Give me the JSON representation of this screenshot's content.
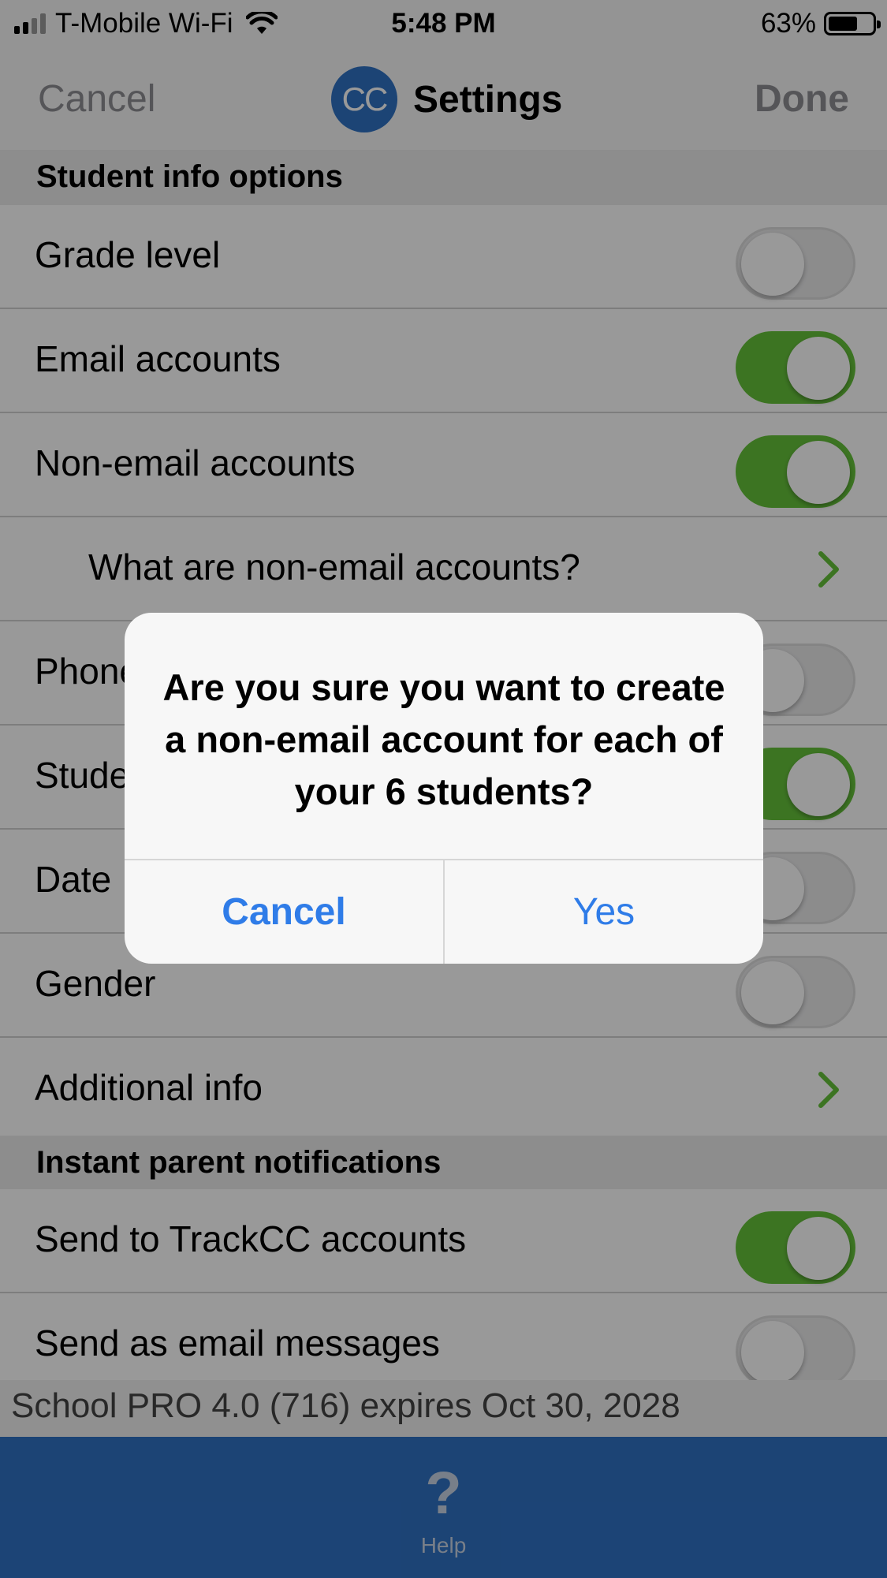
{
  "status_bar": {
    "carrier": "T-Mobile Wi-Fi",
    "time": "5:48 PM",
    "battery": "63%"
  },
  "nav": {
    "cancel": "Cancel",
    "logo_text": "CC",
    "title": "Settings",
    "done": "Done"
  },
  "sections": {
    "student_info": {
      "header": "Student info options",
      "rows": [
        {
          "label": "Grade level",
          "control": "toggle",
          "on": false
        },
        {
          "label": "Email accounts",
          "control": "toggle",
          "on": true
        },
        {
          "label": "Non-email accounts",
          "control": "toggle",
          "on": true
        },
        {
          "label": "What are non-email accounts?",
          "control": "chevron"
        },
        {
          "label": "Phone",
          "control": "toggle",
          "on": false
        },
        {
          "label": "Student",
          "control": "toggle",
          "on": true
        },
        {
          "label": "Date",
          "control": "toggle",
          "on": false
        },
        {
          "label": "Gender",
          "control": "toggle",
          "on": false
        },
        {
          "label": "Additional info",
          "control": "chevron"
        }
      ]
    },
    "parent_notifications": {
      "header": "Instant parent notifications",
      "rows": [
        {
          "label": "Send to TrackCC accounts",
          "control": "toggle",
          "on": true
        },
        {
          "label": "Send as email messages",
          "control": "toggle",
          "on": false
        }
      ]
    }
  },
  "footer": {
    "version_text": "School PRO 4.0 (716) expires Oct 30, 2028"
  },
  "tab_bar": {
    "help_icon": "?",
    "help_label": "Help"
  },
  "alert": {
    "message": "Are you sure you want to create a non-email account for each of your 6 students?",
    "cancel": "Cancel",
    "confirm": "Yes"
  },
  "colors": {
    "accent": "#2f72c4",
    "toggle_on": "#65c23a",
    "alert_button": "#2f7ce8"
  },
  "icons": {
    "chevron": "chevron-right-icon",
    "wifi": "wifi-icon",
    "battery": "battery-icon",
    "signal": "cellular-signal-icon",
    "help": "question-mark-icon"
  }
}
